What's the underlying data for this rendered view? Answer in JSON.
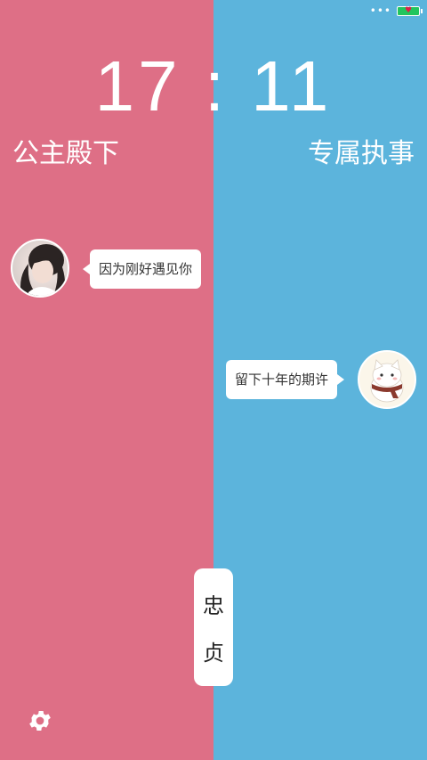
{
  "status_bar": {
    "signal_icon": "dots-icon",
    "battery_icon": "battery-heart-icon"
  },
  "clock": {
    "time": "17 : 11"
  },
  "left_panel": {
    "title": "公主殿下",
    "avatar_icon": "girl-avatar",
    "message": "因为刚好遇见你",
    "bg_color": "#de6f86"
  },
  "right_panel": {
    "title": "专属执事",
    "avatar_icon": "cat-avatar",
    "message": "留下十年的期许",
    "bg_color": "#5cb4dc"
  },
  "center_label": {
    "line1": "忠",
    "line2": "贞"
  },
  "settings": {
    "icon": "gear-icon"
  }
}
